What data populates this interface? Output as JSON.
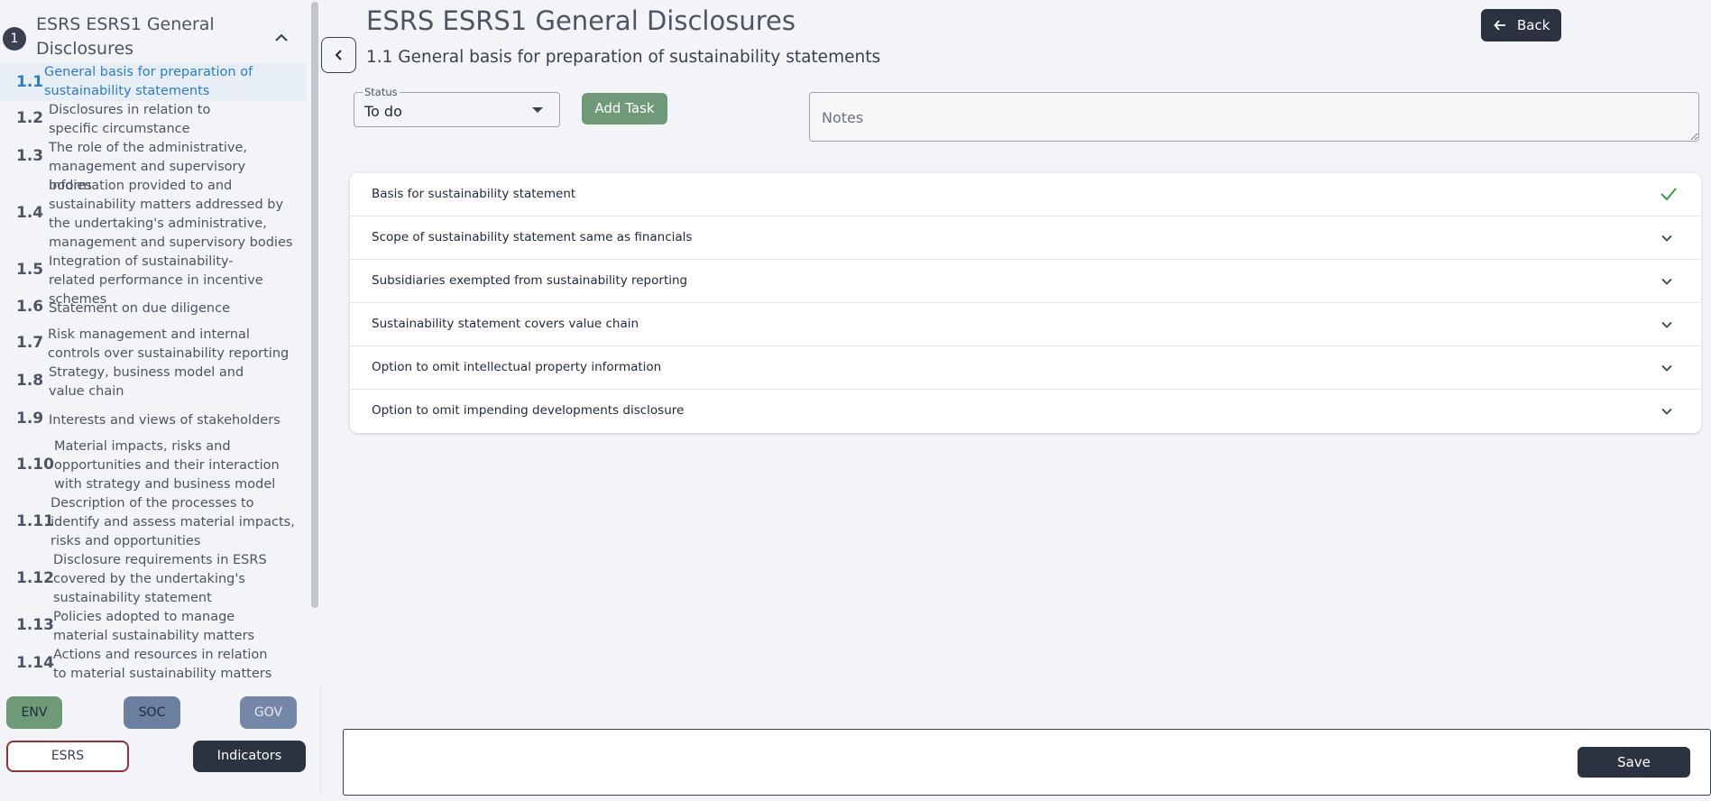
{
  "sidebar": {
    "section_number": "1",
    "section_title": "ESRS ESRS1 General Disclosures",
    "items": [
      {
        "num": "1.1",
        "label": "General basis for preparation of sustainability statements"
      },
      {
        "num": "1.2",
        "label": "Disclosures in relation to specific circumstance"
      },
      {
        "num": "1.3",
        "label": "The role of the administrative, management and supervisory bodies"
      },
      {
        "num": "1.4",
        "label": "Information provided to and sustainability matters addressed by the undertaking's administrative, management and supervisory bodies"
      },
      {
        "num": "1.5",
        "label": "Integration of sustainability-related performance in incentive schemes"
      },
      {
        "num": "1.6",
        "label": "Statement on due diligence"
      },
      {
        "num": "1.7",
        "label": "Risk management and internal controls over sustainability reporting"
      },
      {
        "num": "1.8",
        "label": "Strategy, business model and value chain"
      },
      {
        "num": "1.9",
        "label": "Interests and views of stakeholders"
      },
      {
        "num": "1.10",
        "label": "Material impacts, risks and opportunities and their interaction with strategy and business model"
      },
      {
        "num": "1.11",
        "label": "Description of the processes to identify and assess material impacts, risks and opportunities"
      },
      {
        "num": "1.12",
        "label": "Disclosure requirements in ESRS covered by the undertaking's sustainability statement"
      },
      {
        "num": "1.13",
        "label": "Policies adopted to manage material sustainability matters"
      },
      {
        "num": "1.14",
        "label": "Actions and resources in relation to material sustainability matters"
      }
    ],
    "categories": {
      "env": "ENV",
      "soc": "SOC",
      "gov": "GOV"
    },
    "esrs_label": "ESRS",
    "indicators_label": "Indicators"
  },
  "header": {
    "title": "ESRS ESRS1 General Disclosures",
    "subtitle": "1.1 General basis for preparation of sustainability statements",
    "back_label": "Back"
  },
  "form": {
    "status_legend": "Status",
    "status_value": "To do",
    "add_task_label": "Add Task",
    "notes_placeholder": "Notes"
  },
  "accordion": [
    {
      "label": "Basis for sustainability statement",
      "icon": "check-icon"
    },
    {
      "label": "Scope of sustainability statement same as financials",
      "icon": "chevron-down-icon"
    },
    {
      "label": "Subsidiaries exempted from sustainability reporting",
      "icon": "chevron-down-icon"
    },
    {
      "label": "Sustainability statement covers value chain",
      "icon": "chevron-down-icon"
    },
    {
      "label": "Option to omit intellectual property information",
      "icon": "chevron-down-icon"
    },
    {
      "label": "Option to omit impending developments disclosure",
      "icon": "chevron-down-icon"
    }
  ],
  "footer": {
    "save_label": "Save"
  },
  "colors": {
    "active": "#2b7cc9",
    "dark": "#2c3340",
    "green": "#6e9a78",
    "check": "#3a9a4a",
    "esrs_border": "#9b2c3c"
  }
}
